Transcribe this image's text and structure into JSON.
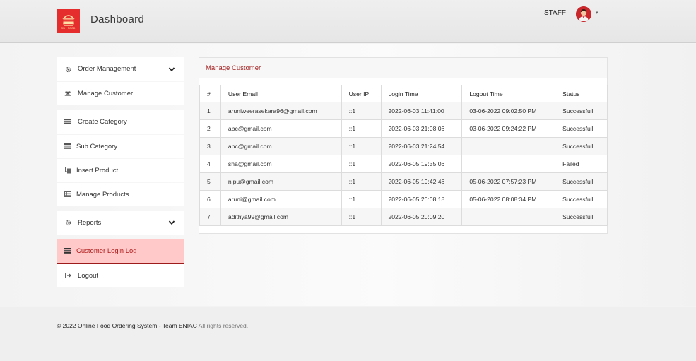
{
  "header": {
    "logo_text": "ON · FOOD",
    "title": "Dashboard",
    "user_role": "STAFF",
    "avatar_caret": "▾"
  },
  "sidebar": {
    "items": [
      {
        "label": "Order Management",
        "icon": "gear-icon",
        "expandable": true
      },
      {
        "label": "Manage Customer",
        "icon": "users-icon"
      },
      {
        "label": "Create Category",
        "icon": "list-icon"
      },
      {
        "label": "Sub Category",
        "icon": "list-icon"
      },
      {
        "label": "Insert Product",
        "icon": "copy-icon"
      },
      {
        "label": "Manage Products",
        "icon": "table-icon"
      },
      {
        "label": "Reports",
        "icon": "gear-icon",
        "expandable": true
      },
      {
        "label": "Customer Login Log",
        "icon": "list-icon",
        "active": true
      },
      {
        "label": "Logout",
        "icon": "logout-icon"
      }
    ]
  },
  "panel": {
    "title": "Manage Customer",
    "columns": [
      "#",
      "User Email",
      "User IP",
      "Login Time",
      "Logout Time",
      "Status"
    ],
    "rows": [
      [
        "1",
        "aruniweerasekara96@gmail.com",
        "::1",
        "2022-06-03 11:41:00",
        "03-06-2022 09:02:50 PM",
        "Successfull"
      ],
      [
        "2",
        "abc@gmail.com",
        "::1",
        "2022-06-03 21:08:06",
        "03-06-2022 09:24:22 PM",
        "Successfull"
      ],
      [
        "3",
        "abc@gmail.com",
        "::1",
        "2022-06-03 21:24:54",
        "",
        "Successfull"
      ],
      [
        "4",
        "sha@gmail.com",
        "::1",
        "2022-06-05 19:35:06",
        "",
        "Failed"
      ],
      [
        "5",
        "nipu@gmail.com",
        "::1",
        "2022-06-05 19:42:46",
        "05-06-2022 07:57:23 PM",
        "Successfull"
      ],
      [
        "6",
        "aruni@gmail.com",
        "::1",
        "2022-06-05 20:08:18",
        "05-06-2022 08:08:34 PM",
        "Successfull"
      ],
      [
        "7",
        "adithya99@gmail.com",
        "::1",
        "2022-06-05 20:09:20",
        "",
        "Successfull"
      ]
    ]
  },
  "footer": {
    "copyright": "© 2022 Online Food Ordering System - Team ENIAC",
    "rights": " All rights reserved."
  },
  "colors": {
    "accent": "#9e1b1b",
    "active_bg": "#ffc9c9",
    "logo_bg": "#e52d2d"
  }
}
